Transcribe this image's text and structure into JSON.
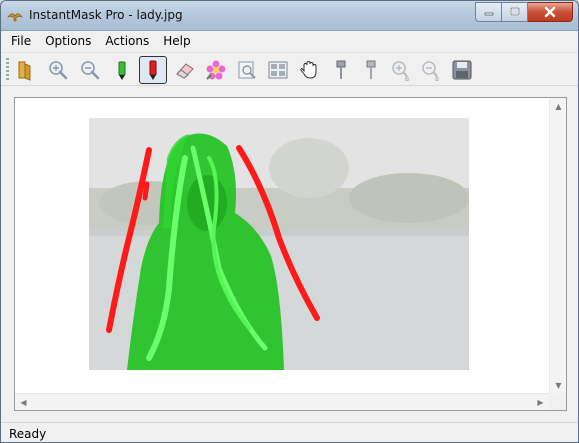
{
  "window": {
    "title": "InstantMask Pro - lady.jpg",
    "icon": "bird-logo-icon"
  },
  "window_controls": {
    "minimize_icon": "minimize-icon",
    "maximize_icon": "maximize-icon",
    "close_icon": "close-icon"
  },
  "menubar": {
    "items": [
      {
        "label": "File"
      },
      {
        "label": "Options"
      },
      {
        "label": "Actions"
      },
      {
        "label": "Help"
      }
    ]
  },
  "toolbar": {
    "tools": [
      {
        "icon": "open-folder-icon",
        "selected": false
      },
      {
        "icon": "zoom-in-icon",
        "selected": false
      },
      {
        "icon": "zoom-out-icon",
        "selected": false
      },
      {
        "icon": "green-marker-icon",
        "selected": false
      },
      {
        "icon": "red-marker-icon",
        "selected": true
      },
      {
        "icon": "eraser-icon",
        "selected": false
      },
      {
        "icon": "flower-icon",
        "selected": false
      },
      {
        "icon": "preview-icon",
        "selected": false
      },
      {
        "icon": "layout-icon",
        "selected": false
      },
      {
        "icon": "hand-pan-icon",
        "selected": false
      },
      {
        "icon": "brush-icon",
        "selected": false
      },
      {
        "icon": "brush-alt-icon",
        "selected": false
      },
      {
        "icon": "brush-zoom-in-icon",
        "selected": false
      },
      {
        "icon": "brush-zoom-out-icon",
        "selected": false
      },
      {
        "icon": "save-icon",
        "selected": false
      }
    ]
  },
  "canvas": {
    "image": "lady.jpg masked portrait",
    "mask_foreground_color": "#22c222",
    "mask_background_color": "#ff1a1a"
  },
  "statusbar": {
    "text": "Ready"
  },
  "colors": {
    "titlebar": "#b6c9dd",
    "close_button": "#c9503a",
    "chrome": "#f0f0f0"
  }
}
